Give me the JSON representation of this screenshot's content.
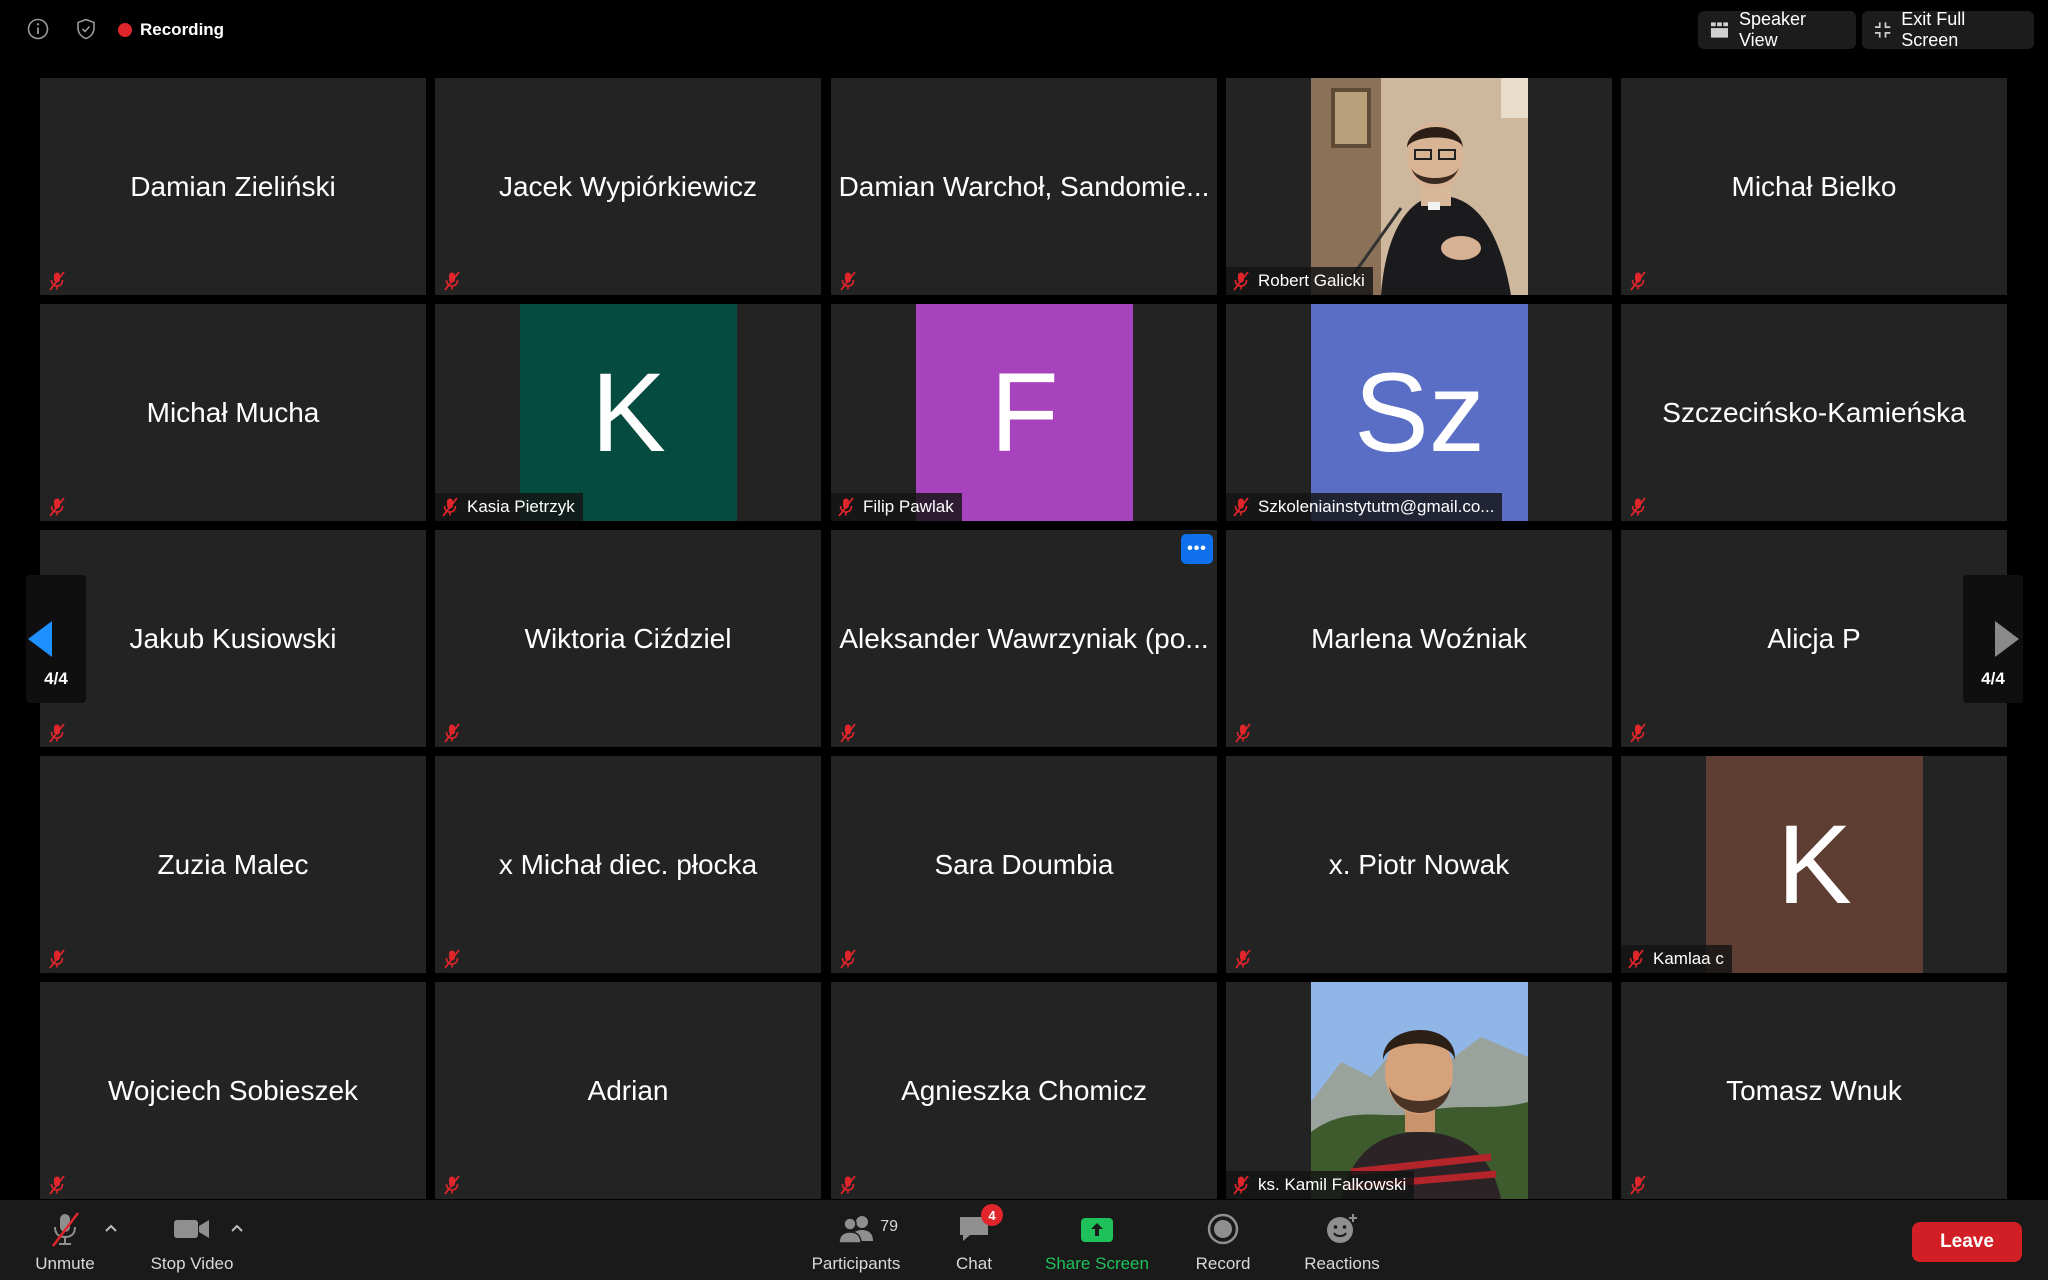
{
  "topbar": {
    "recording_label": "Recording",
    "speaker_view_label": "Speaker View",
    "exit_fullscreen_label": "Exit Full Screen"
  },
  "grid": {
    "page_left": "4/4",
    "page_right": "4/4",
    "tiles": [
      {
        "name": "Damian Zieliński",
        "kind": "name"
      },
      {
        "name": "Jacek Wypiórkiewicz",
        "kind": "name"
      },
      {
        "name": "Damian Warchoł, Sandomie...",
        "kind": "name"
      },
      {
        "name": "Robert Galicki",
        "kind": "photo"
      },
      {
        "name": "Michał Bielko",
        "kind": "name"
      },
      {
        "name": "Michał Mucha",
        "kind": "name"
      },
      {
        "name": "Kasia Pietrzyk",
        "kind": "avatar",
        "initials": "K",
        "color": "#054b3f"
      },
      {
        "name": "Filip Pawlak",
        "kind": "avatar",
        "initials": "F",
        "color": "#a744bd"
      },
      {
        "name": "Szkoleniainstytutm@gmail.co...",
        "kind": "avatar",
        "initials": "Sz",
        "color": "#5a6ec6"
      },
      {
        "name": "Szczecińsko-Kamieńska",
        "kind": "name"
      },
      {
        "name": "Jakub Kusiowski",
        "kind": "name"
      },
      {
        "name": "Wiktoria Ciździel",
        "kind": "name"
      },
      {
        "name": "Aleksander Wawrzyniak (po...",
        "kind": "name",
        "more": "•••"
      },
      {
        "name": "Marlena Woźniak",
        "kind": "name"
      },
      {
        "name": "Alicja P",
        "kind": "name"
      },
      {
        "name": "Zuzia Malec",
        "kind": "name"
      },
      {
        "name": "x Michał diec. płocka",
        "kind": "name"
      },
      {
        "name": "Sara Doumbia",
        "kind": "name"
      },
      {
        "name": "x. Piotr Nowak",
        "kind": "name"
      },
      {
        "name": "Kamlaa c",
        "kind": "avatar",
        "initials": "K",
        "color": "#5e3d33"
      },
      {
        "name": "Wojciech Sobieszek",
        "kind": "name"
      },
      {
        "name": "Adrian",
        "kind": "name"
      },
      {
        "name": "Agnieszka Chomicz",
        "kind": "name"
      },
      {
        "name": "ks. Kamil Falkowski",
        "kind": "photo2"
      },
      {
        "name": "Tomasz Wnuk",
        "kind": "name"
      }
    ]
  },
  "toolbar": {
    "unmute_label": "Unmute",
    "stop_video_label": "Stop Video",
    "participants_label": "Participants",
    "participants_count": "79",
    "chat_label": "Chat",
    "chat_badge": "4",
    "share_screen_label": "Share Screen",
    "record_label": "Record",
    "reactions_label": "Reactions",
    "leave_label": "Leave"
  }
}
